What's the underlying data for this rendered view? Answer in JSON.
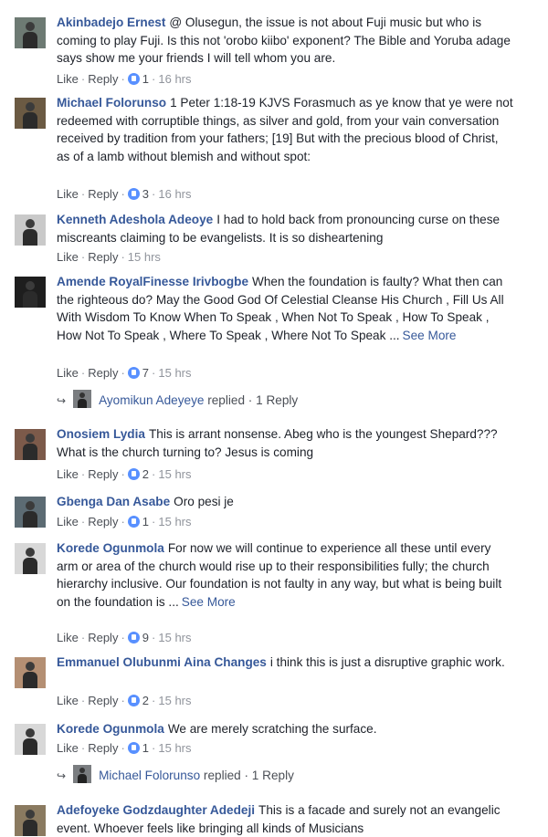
{
  "comments": [
    {
      "author": "Akinbadejo Ernest",
      "text": "@ Olusegun, the issue is not about Fuji music but who is coming to play Fuji. Is this not 'orobo kiibo' exponent? The Bible and Yoruba adage says show me your friends I will tell whom you are.",
      "like": "Like",
      "reply": "Reply",
      "likes": "1",
      "time": "16 hrs",
      "avatar_color": "#6d7a73"
    },
    {
      "author": "Michael Folorunso",
      "text": "1 Peter 1:18-19 KJVS Forasmuch as ye know that ye were not redeemed with corruptible things, as silver and gold, from your vain conversation received by tradition from your fathers; [19] But with the precious blood of Christ, as of a lamb without blemish and without spot:",
      "like": "Like",
      "reply": "Reply",
      "likes": "3",
      "time": "16 hrs",
      "avatar_color": "#6b5a43"
    },
    {
      "author": "Kenneth Adeshola Adeoye",
      "text": "I had to hold back from pronouncing curse on these miscreants claiming to be evangelists. It is so disheartening",
      "like": "Like",
      "reply": "Reply",
      "likes": "",
      "time": "15 hrs",
      "avatar_color": "#c9c9c9"
    },
    {
      "author": "Amende RoyalFinesse Irivbogbe",
      "text": "When the foundation is faulty? What then can the righteous do? May the Good God Of Celestial Cleanse His Church , Fill Us All With Wisdom To Know When To Speak , When Not To Speak , How To Speak , How Not To Speak , Where To Speak , Where Not To Speak ...",
      "see_more": "See More",
      "like": "Like",
      "reply": "Reply",
      "likes": "7",
      "time": "15 hrs",
      "avatar_color": "#1e1e1e",
      "reply_summary": {
        "name": "Ayomikun Adeyeye",
        "text": "replied · 1 Reply"
      }
    },
    {
      "author": "Onosiem Lydia",
      "text": "This is arrant nonsense. Abeg who is the youngest Shepard??? What is the church turning to? Jesus is coming",
      "like": "Like",
      "reply": "Reply",
      "likes": "2",
      "time": "15 hrs",
      "avatar_color": "#7c5a4a"
    },
    {
      "author": "Gbenga Dan Asabe",
      "text": "Oro pesi je",
      "like": "Like",
      "reply": "Reply",
      "likes": "1",
      "time": "15 hrs",
      "avatar_color": "#5c6b73"
    },
    {
      "author": "Korede Ogunmola",
      "text": "For now we will continue to experience all these until every arm or area of the church would rise up to their responsibilities fully; the church hierarchy inclusive. Our foundation is not faulty in any way, but what is being built on the foundation is ...",
      "see_more": "See More",
      "like": "Like",
      "reply": "Reply",
      "likes": "9",
      "time": "15 hrs",
      "avatar_color": "#d8d8d8"
    },
    {
      "author": "Emmanuel Olubunmi Aina Changes",
      "text": "i think this is just a disruptive graphic work.",
      "like": "Like",
      "reply": "Reply",
      "likes": "2",
      "time": "15 hrs",
      "avatar_color": "#b48f73"
    },
    {
      "author": "Korede Ogunmola",
      "text": "We are merely scratching the surface.",
      "like": "Like",
      "reply": "Reply",
      "likes": "1",
      "time": "15 hrs",
      "avatar_color": "#d8d8d8",
      "reply_summary": {
        "name": "Michael Folorunso",
        "text": "replied · 1 Reply"
      }
    },
    {
      "author": "Adefoyeke Godzdaughter Adedeji",
      "text": "This is a facade and surely not an evangelic event. Whoever feels like bringing all kinds of Musicians",
      "avatar_color": "#8a7a60"
    }
  ],
  "colors": {
    "link": "#365899",
    "meta": "#90949c",
    "like_badge": "#5890ff"
  },
  "icons": {
    "like_badge": "thumbs-up-icon",
    "reply_arrow": "reply-arrow-icon"
  }
}
